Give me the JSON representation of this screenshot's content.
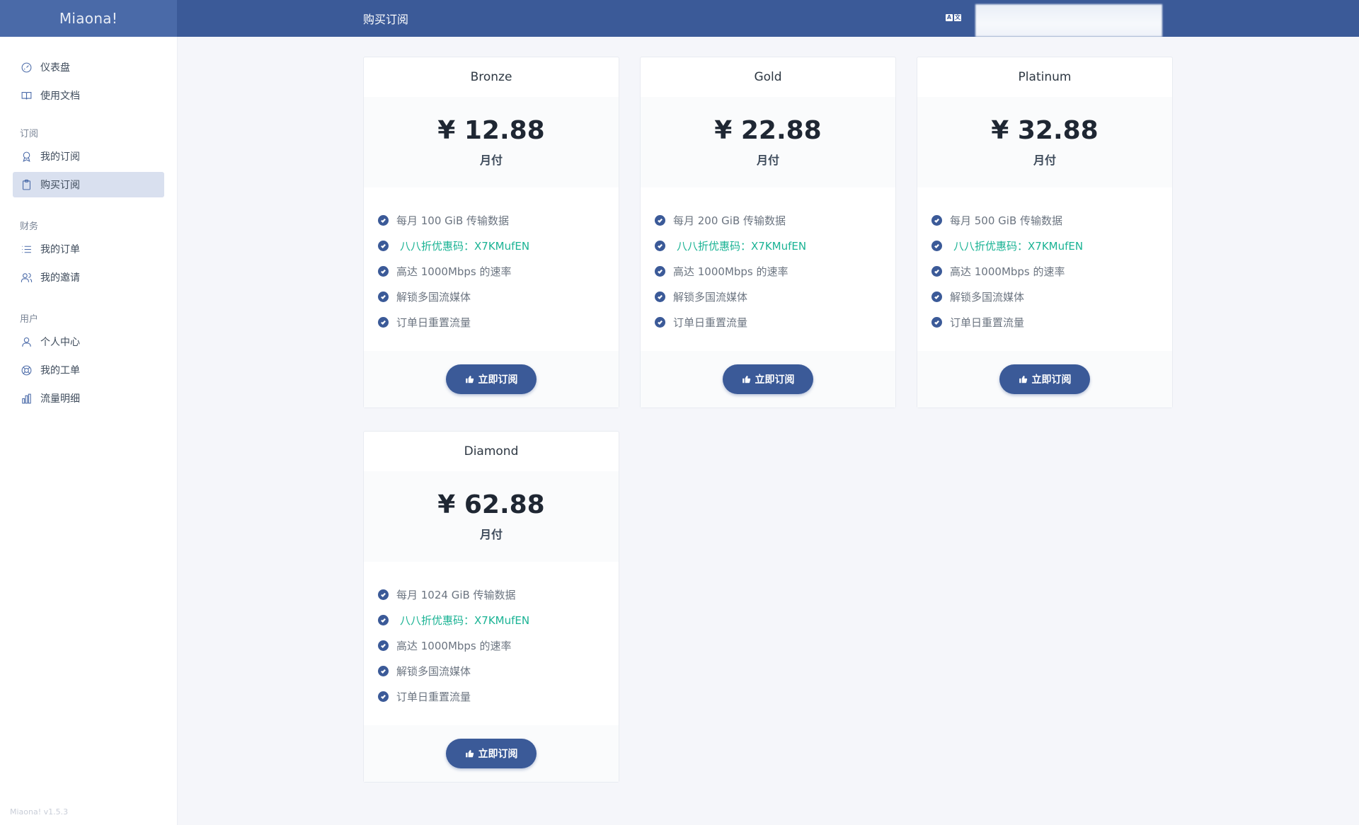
{
  "header": {
    "brand": "Miaona!",
    "page_title": "购买订阅",
    "lang_icon": "translate-icon"
  },
  "sidebar": {
    "items_top": [
      {
        "label": "仪表盘",
        "icon": "dashboard-icon"
      },
      {
        "label": "使用文档",
        "icon": "book-icon"
      }
    ],
    "groups": [
      {
        "title": "订阅",
        "items": [
          {
            "label": "我的订阅",
            "icon": "award-icon"
          },
          {
            "label": "购买订阅",
            "icon": "clipboard-icon",
            "active": true
          }
        ]
      },
      {
        "title": "财务",
        "items": [
          {
            "label": "我的订单",
            "icon": "list-icon"
          },
          {
            "label": "我的邀请",
            "icon": "users-icon"
          }
        ]
      },
      {
        "title": "用户",
        "items": [
          {
            "label": "个人中心",
            "icon": "user-icon"
          },
          {
            "label": "我的工单",
            "icon": "lifebuoy-icon"
          },
          {
            "label": "流量明细",
            "icon": "bar-chart-icon"
          }
        ]
      }
    ],
    "version": "Miaona! v1.5.3"
  },
  "plans": [
    {
      "name": "Bronze",
      "price": "¥ 12.88",
      "period": "月付",
      "features": [
        "每月 100 GiB 传输数据",
        "八八折优惠码：X7KMufEN",
        "高达 1000Mbps 的速率",
        "解锁多国流媒体",
        "订单日重置流量"
      ],
      "button": "立即订阅"
    },
    {
      "name": "Gold",
      "price": "¥ 22.88",
      "period": "月付",
      "features": [
        "每月 200 GiB 传输数据",
        "八八折优惠码：X7KMufEN",
        "高达 1000Mbps 的速率",
        "解锁多国流媒体",
        "订单日重置流量"
      ],
      "button": "立即订阅"
    },
    {
      "name": "Platinum",
      "price": "¥ 32.88",
      "period": "月付",
      "features": [
        "每月 500 GiB 传输数据",
        "八八折优惠码：X7KMufEN",
        "高达 1000Mbps 的速率",
        "解锁多国流媒体",
        "订单日重置流量"
      ],
      "button": "立即订阅"
    },
    {
      "name": "Diamond",
      "price": "¥ 62.88",
      "period": "月付",
      "features": [
        "每月 1024 GiB 传输数据",
        "八八折优惠码：X7KMufEN",
        "高达 1000Mbps 的速率",
        "解锁多国流媒体",
        "订单日重置流量"
      ],
      "button": "立即订阅"
    }
  ],
  "colors": {
    "header": "#3b5a98",
    "brand_bg": "#4a6aa8",
    "accent": "#3b5a98",
    "promo": "#1ab394",
    "active_nav": "#d9e0ef"
  }
}
